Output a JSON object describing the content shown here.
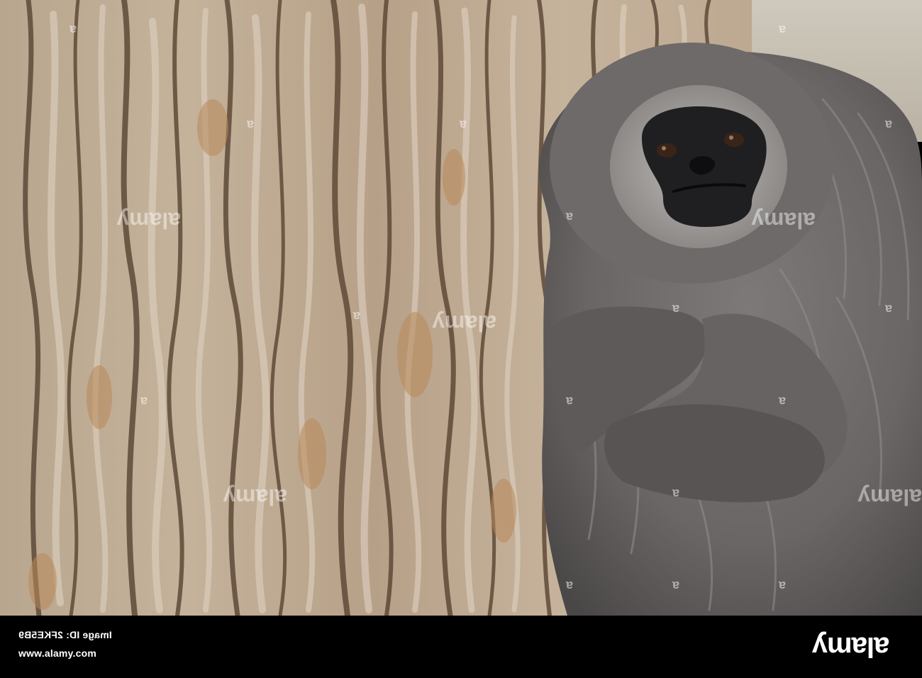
{
  "photo": {
    "subject": "gibbon-icon",
    "background": "tree-bark",
    "colors": {
      "bark_light": "#c9b8a2",
      "bark_mid": "#a48a6c",
      "bark_dark": "#5e4a38",
      "bark_orange": "#b8885a",
      "fur_light": "#9a9796",
      "fur_mid": "#6f6c6b",
      "fur_dark": "#3e3c3c",
      "face": "#1c1c1e"
    }
  },
  "watermark": {
    "text": "alamy",
    "small_mark": "a"
  },
  "footer": {
    "image_id_label": "Image ID: 2FKE5B9",
    "site_url": "www.alamy.com",
    "logo_text": "alamy"
  }
}
